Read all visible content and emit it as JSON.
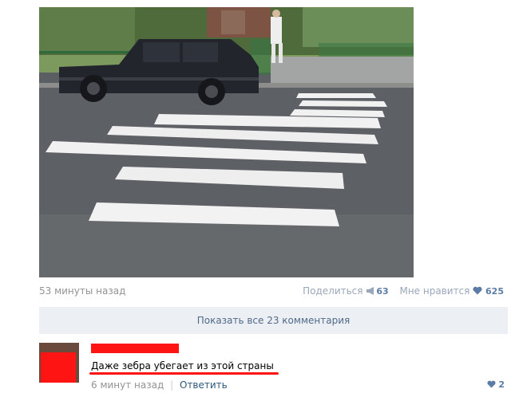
{
  "post": {
    "time": "53 минуты назад",
    "share_label": "Поделиться",
    "share_count": "63",
    "like_label": "Мне нравится",
    "like_count": "625"
  },
  "comments": {
    "show_all_label": "Показать все 23 комментария",
    "items": [
      {
        "text": "Даже зебра убегает из этой страны",
        "time": "6 минут назад",
        "separator": "|",
        "reply_label": "Ответить",
        "likes": "2"
      }
    ]
  },
  "colors": {
    "link": "#2b587a",
    "muted": "#939393",
    "censor_red": "#ff1414",
    "show_comments_bg": "#eceff3"
  },
  "icons": [
    "megaphone-icon",
    "heart-icon"
  ]
}
